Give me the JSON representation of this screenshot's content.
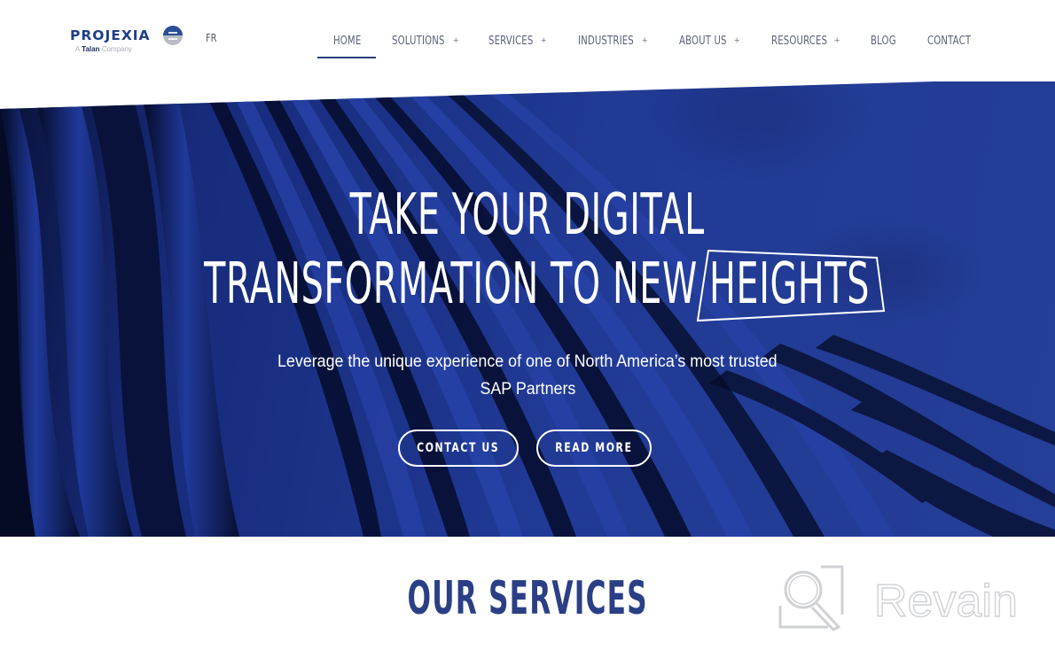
{
  "header": {
    "logo": {
      "name": "PROJEXIA",
      "tagline_prefix": "A",
      "tagline_brand": "Talan",
      "tagline_suffix": "Company",
      "icon": "projexia-badge-icon"
    },
    "language_switch": "FR",
    "nav": [
      {
        "label": "HOME",
        "has_submenu": false,
        "active": true
      },
      {
        "label": "SOLUTIONS",
        "has_submenu": true,
        "active": false
      },
      {
        "label": "SERVICES",
        "has_submenu": true,
        "active": false
      },
      {
        "label": "INDUSTRIES",
        "has_submenu": true,
        "active": false
      },
      {
        "label": "ABOUT US",
        "has_submenu": true,
        "active": false
      },
      {
        "label": "RESOURCES",
        "has_submenu": true,
        "active": false
      },
      {
        "label": "BLOG",
        "has_submenu": false,
        "active": false
      },
      {
        "label": "CONTACT",
        "has_submenu": false,
        "active": false
      }
    ],
    "submenu_symbol": "+"
  },
  "hero": {
    "title_line1": "TAKE YOUR DIGITAL",
    "title_line2_prefix": "TRANSFORMATION TO NEW",
    "title_line2_highlight": "HEIGHTS",
    "subtitle_line1": "Leverage the unique experience of one of North America’s most trusted",
    "subtitle_line2": "SAP Partners",
    "buttons": {
      "contact": "CONTACT US",
      "read_more": "READ MORE"
    }
  },
  "services": {
    "title": "OUR SERVICES"
  },
  "watermark": {
    "text": "Revain",
    "icon": "revain-logo-icon"
  },
  "colors": {
    "brand_blue": "#1e3f87",
    "nav_text": "#5b6177",
    "hero_blue": "#2945a2",
    "services_title": "#2a3f86"
  }
}
